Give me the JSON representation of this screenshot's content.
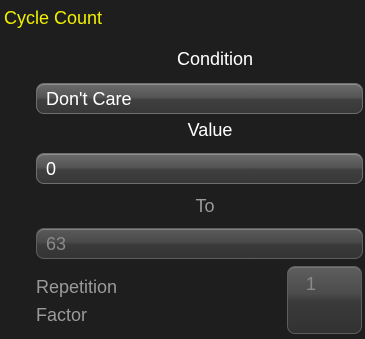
{
  "panel": {
    "title": "Cycle Count",
    "condition_label": "Condition",
    "condition_value": "Don't Care",
    "value_label": "Value",
    "value_value": "0",
    "to_label": "To",
    "to_value": "63",
    "repetition_label_line1": "Repetition",
    "repetition_label_line2": "Factor",
    "repetition_value": "1"
  },
  "colors": {
    "title": "#f0f000",
    "background": "#1e1e1e",
    "text": "#ffffff",
    "disabled_text": "#9a9a9a"
  }
}
